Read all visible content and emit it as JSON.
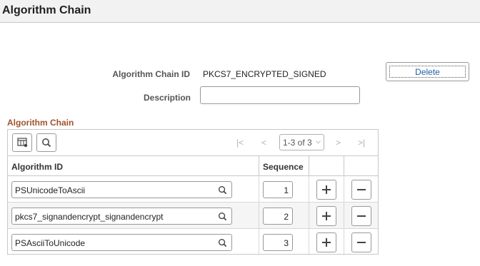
{
  "page": {
    "title": "Algorithm Chain"
  },
  "form": {
    "chain_id_label": "Algorithm Chain ID",
    "chain_id_value": "PKCS7_ENCRYPTED_SIGNED",
    "description_label": "Description",
    "description_value": "",
    "delete_label": "Delete"
  },
  "grid": {
    "title": "Algorithm Chain",
    "pager": {
      "range": "1-3 of 3"
    },
    "columns": {
      "algorithm_id": "Algorithm ID",
      "sequence": "Sequence"
    },
    "rows": [
      {
        "algorithm_id": "PSUnicodeToAscii",
        "sequence": "1"
      },
      {
        "algorithm_id": "pkcs7_signandencrypt_signandencrypt",
        "sequence": "2"
      },
      {
        "algorithm_id": "PSAsciiToUnicode",
        "sequence": "3"
      }
    ]
  },
  "icons": {
    "personalize": "grid-personalize-icon",
    "find": "search-icon",
    "first": "first-page-icon",
    "prev": "previous-page-icon",
    "next": "next-page-icon",
    "last": "last-page-icon",
    "add": "plus-icon",
    "remove": "minus-icon"
  },
  "colors": {
    "grid_title": "#a0522d",
    "link": "#1f5fa8"
  }
}
